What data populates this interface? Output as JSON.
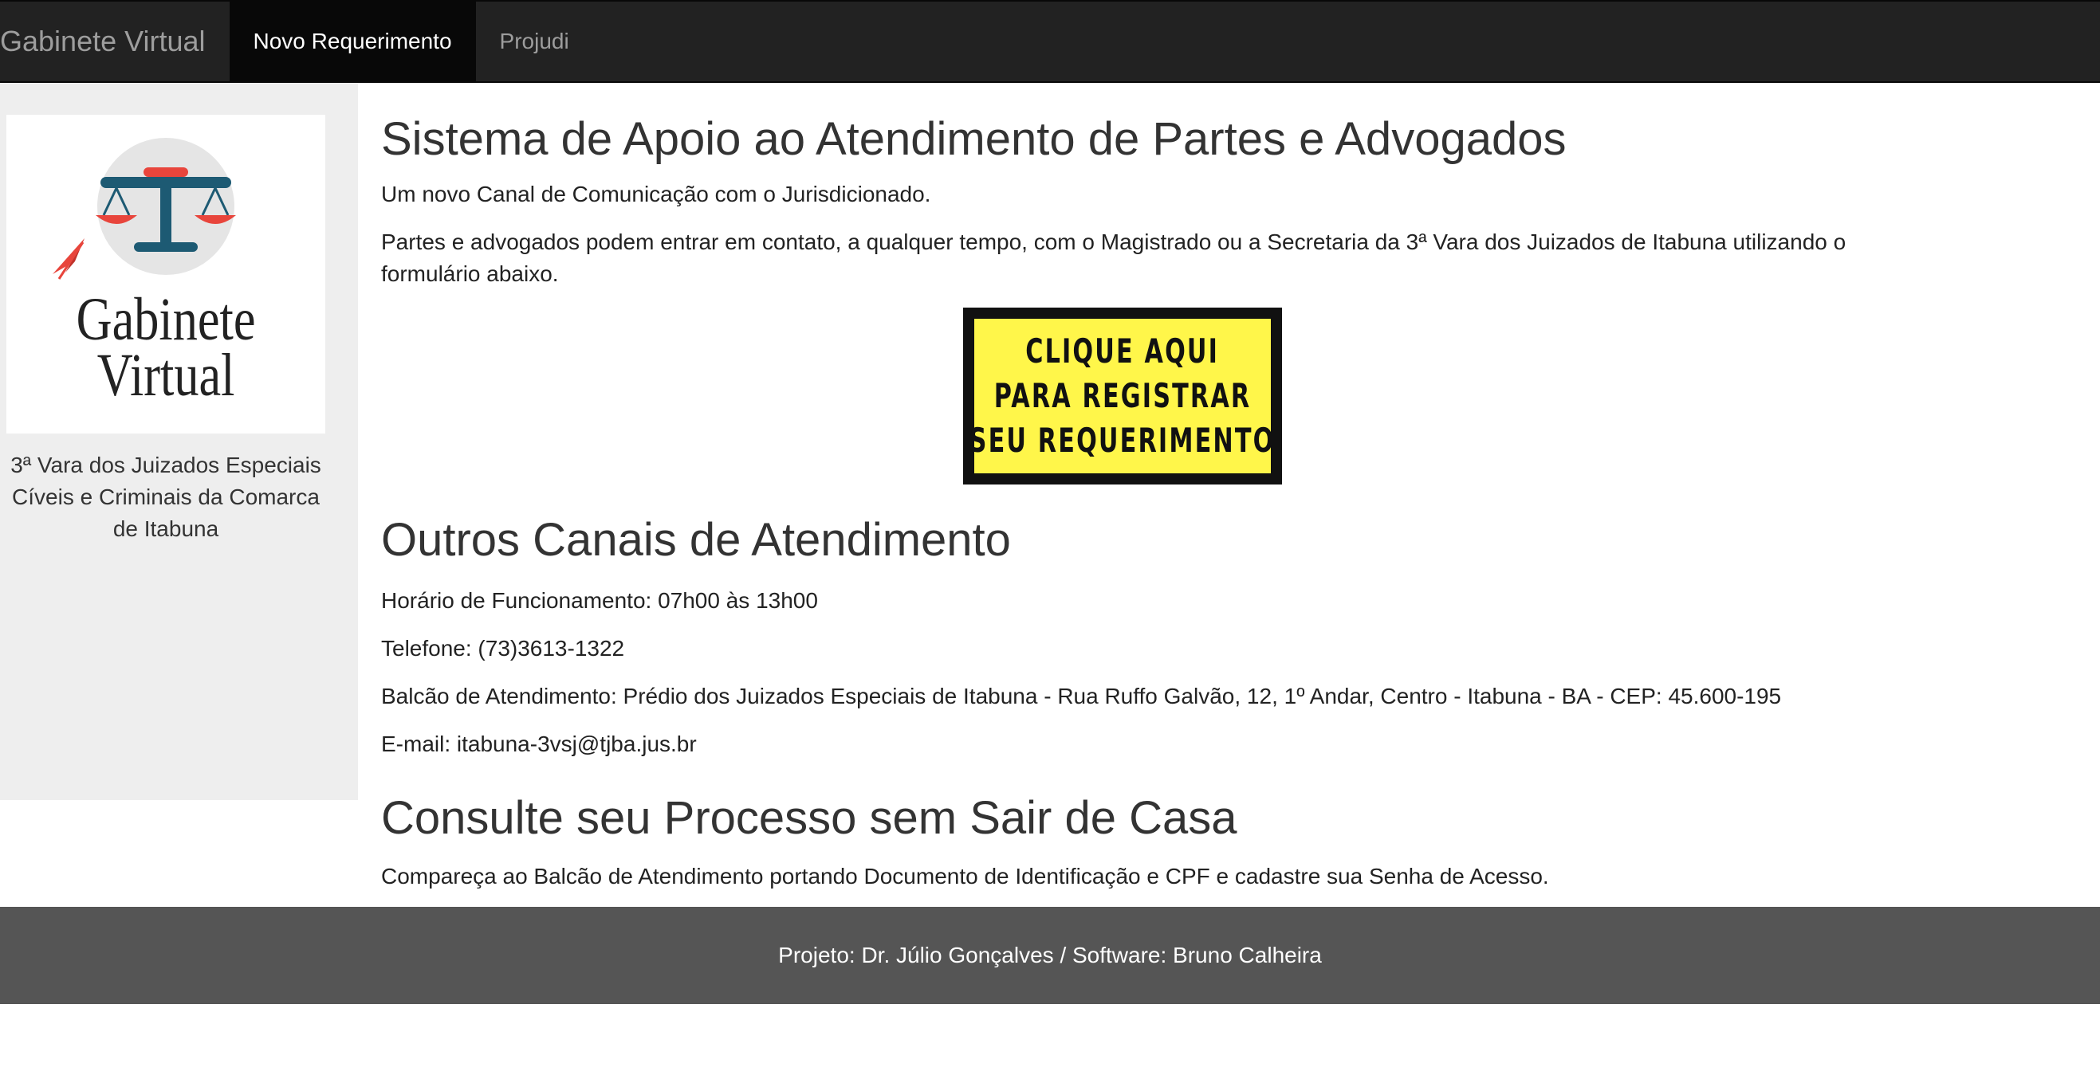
{
  "navbar": {
    "brand": "Gabinete Virtual",
    "items": [
      {
        "label": "Novo Requerimento",
        "active": true
      },
      {
        "label": "Projudi",
        "active": false
      }
    ]
  },
  "sidebar": {
    "logo_text_line1": "Gabinete",
    "logo_text_line2": "Virtual",
    "caption": "3ª Vara dos Juizados Especiais Cíveis e Criminais da Comarca de Itabuna"
  },
  "main": {
    "title": "Sistema de Apoio ao Atendimento de Partes e Advogados",
    "intro": "Um novo Canal de Comunicação com o Jurisdicionado.",
    "description": "Partes e advogados podem entrar em contato, a qualquer tempo, com o Magistrado ou a Secretaria da 3ª Vara dos Juizados de Itabuna utilizando o formulário abaixo.",
    "cta": {
      "line1": "CLIQUE AQUI",
      "line2": "PARA REGISTRAR",
      "line3": "SEU REQUERIMENTO"
    },
    "other_channels": {
      "title": "Outros Canais de Atendimento",
      "hours": "Horário de Funcionamento: 07h00 às 13h00",
      "phone": "Telefone: (73)3613-1322",
      "counter": "Balcão de Atendimento: Prédio dos Juizados Especiais de Itabuna - Rua Ruffo Galvão, 12, 1º Andar, Centro - Itabuna - BA - CEP: 45.600-195",
      "email": "E-mail: itabuna-3vsj@tjba.jus.br"
    },
    "consult": {
      "title": "Consulte seu Processo sem Sair de Casa",
      "text": "Compareça ao Balcão de Atendimento portando Documento de Identificação e CPF e cadastre sua Senha de Acesso."
    }
  },
  "footer": {
    "text": "Projeto: Dr. Júlio Gonçalves / Software: Bruno Calheira"
  },
  "colors": {
    "navbar_bg": "#222222",
    "nav_active_bg": "#080808",
    "sidebar_bg": "#eeeeee",
    "cta_bg": "#fff64a",
    "footer_bg": "#555555",
    "logo_blue": "#1d5a73",
    "logo_red": "#e8453c"
  }
}
